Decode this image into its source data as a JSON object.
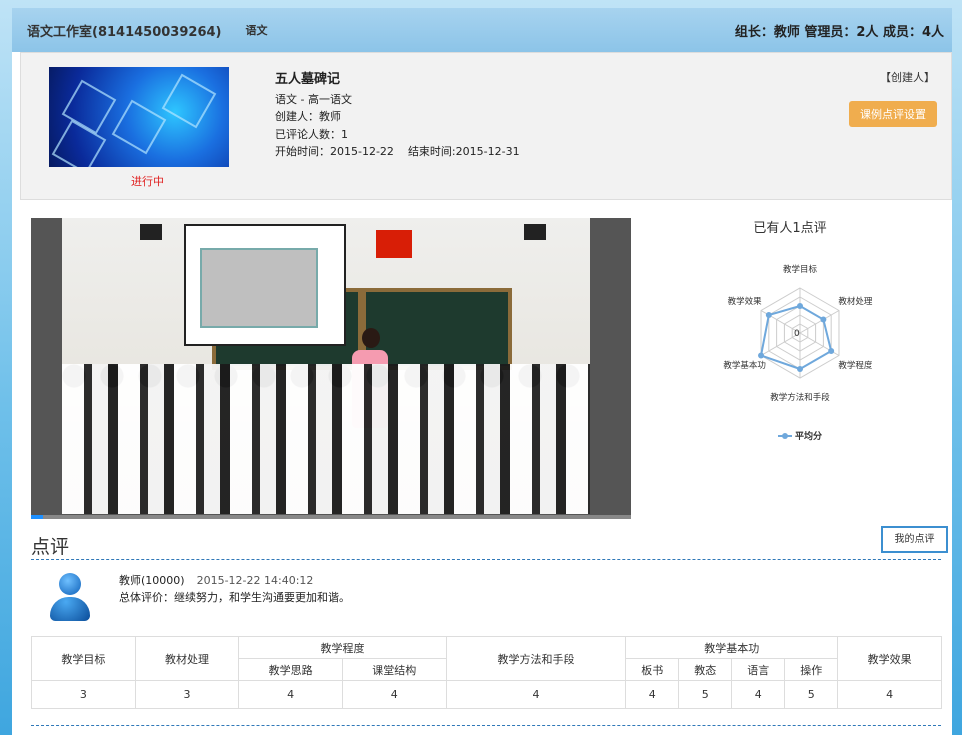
{
  "header": {
    "studio_title": "语文工作室(8141450039264)",
    "subject": "语文",
    "members": "组长：教师 管理员：2人 成员：4人"
  },
  "lesson": {
    "name": "五人墓碑记",
    "course": "语文 - 高一语文",
    "creator": "创建人：教师",
    "review_count": "已评论人数：1",
    "start_time": "开始时间：2015-12-22",
    "end_time": "结束时间:2015-12-31",
    "status": "进行中",
    "creator_tag": "【创建人】",
    "settings_button": "课例点评设置",
    "status_color": "#e02020"
  },
  "video": {
    "progress_fraction": 0.02
  },
  "radar": {
    "title": "已有人1点评",
    "center_label": "0",
    "legend": "平均分",
    "axes": [
      "教学目标",
      "教材处理",
      "教学程度",
      "教学方法和手段",
      "教学基本功",
      "教学效果"
    ],
    "values": [
      3,
      3,
      4,
      4,
      5,
      4
    ],
    "max": 5,
    "color": "#6fa8dc"
  },
  "reviews": {
    "section_title": "点评",
    "my_review_button": "我的点评",
    "items": [
      {
        "author": "教师(10000)",
        "time": "2015-12-22 14:40:12",
        "text": "总体评价：继续努力，和学生沟通要更加和谐。"
      }
    ]
  },
  "score_table": {
    "headers": {
      "h1": "教学目标",
      "h2": "教材处理",
      "h3": "教学程度",
      "h3a": "教学思路",
      "h3b": "课堂结构",
      "h4": "教学方法和手段",
      "h5": "教学基本功",
      "h5a": "板书",
      "h5b": "教态",
      "h5c": "语言",
      "h5d": "操作",
      "h6": "教学效果"
    },
    "values": [
      "3",
      "3",
      "4",
      "4",
      "4",
      "4",
      "5",
      "4",
      "5",
      "4"
    ]
  }
}
